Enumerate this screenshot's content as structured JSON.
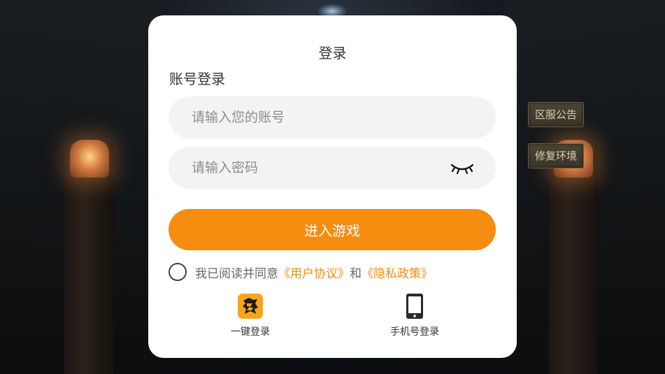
{
  "side_buttons": {
    "notice": "区服公告",
    "repair": "修复环境"
  },
  "dialog": {
    "title": "登录",
    "section_label": "账号登录",
    "account_placeholder": "请输入您的账号",
    "password_placeholder": "请输入密码",
    "enter_button": "进入游戏",
    "agreement": {
      "prefix": "我已阅读并同意",
      "user_agreement": "《用户协议》",
      "and": "和",
      "privacy_policy": "《隐私政策》"
    },
    "alt_logins": [
      {
        "label": "一键登录",
        "icon": "quick-login-dragon-icon"
      },
      {
        "label": "手机号登录",
        "icon": "mobile-phone-icon"
      }
    ]
  },
  "colors": {
    "accent": "#f68c10",
    "field_bg": "#f3f3f3",
    "card_bg": "#ffffff"
  }
}
